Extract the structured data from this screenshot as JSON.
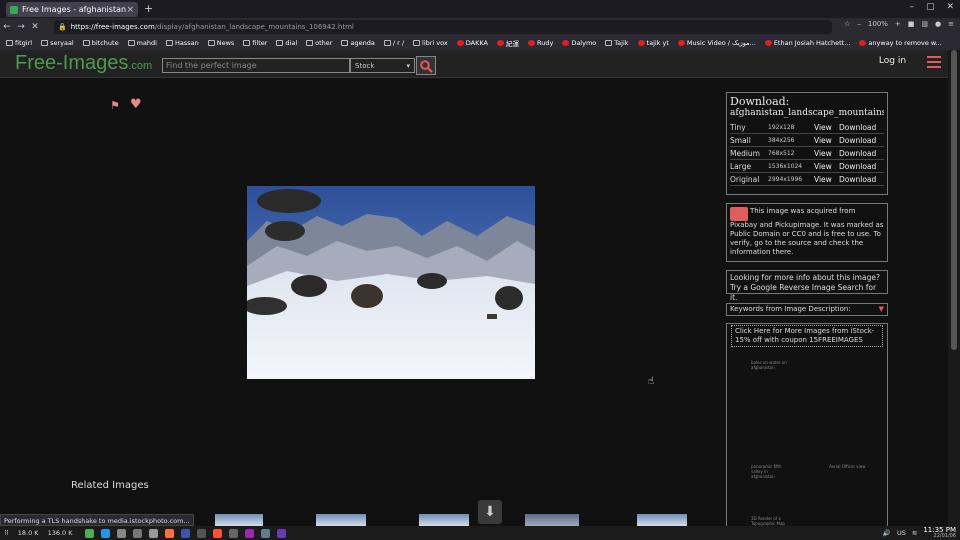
{
  "browser": {
    "tab_title": "Free Images - afghanistan",
    "tab_close": "×",
    "new_tab": "+",
    "url_host": "https://free-images.com",
    "url_path": "/display/afghanistan_landscape_mountains_106942.html",
    "zoom": "100%"
  },
  "bookmarks": [
    {
      "label": "fitgirl",
      "icon": "folder"
    },
    {
      "label": "seryaal",
      "icon": "folder"
    },
    {
      "label": "bitchute",
      "icon": "folder"
    },
    {
      "label": "mahdi",
      "icon": "folder"
    },
    {
      "label": "Hassan",
      "icon": "folder"
    },
    {
      "label": "News",
      "icon": "folder"
    },
    {
      "label": "filter",
      "icon": "folder"
    },
    {
      "label": "dial",
      "icon": "folder"
    },
    {
      "label": "other",
      "icon": "folder"
    },
    {
      "label": "agenda",
      "icon": "folder"
    },
    {
      "label": "/ r /",
      "icon": "folder"
    },
    {
      "label": "libri vox",
      "icon": "folder"
    },
    {
      "label": "DAKKA",
      "icon": "youtube"
    },
    {
      "label": "紀運",
      "icon": "youtube"
    },
    {
      "label": "Rudy",
      "icon": "youtube"
    },
    {
      "label": "Dalymo",
      "icon": "youtube"
    },
    {
      "label": "Tajik",
      "icon": "globe"
    },
    {
      "label": "tajik yt",
      "icon": "youtube"
    },
    {
      "label": "Music Video / موزیک...",
      "icon": "youtube"
    },
    {
      "label": "Ethan Josiah Hatchett...",
      "icon": "youtube"
    },
    {
      "label": "anyway to remove w...",
      "icon": "reddit"
    }
  ],
  "site": {
    "logo_main": "Free-Images",
    "logo_suffix": ".com",
    "search_placeholder": "Find the perfect image",
    "search_scope": "Stock",
    "login": "Log in"
  },
  "download_panel": {
    "title": "Download:",
    "filename": "afghanistan_landscape_mountains...",
    "rows": [
      {
        "name": "Tiny",
        "dims": "192x128",
        "view": "View",
        "download": "Download"
      },
      {
        "name": "Small",
        "dims": "384x256",
        "view": "View",
        "download": "Download"
      },
      {
        "name": "Medium",
        "dims": "768x512",
        "view": "View",
        "download": "Download"
      },
      {
        "name": "Large",
        "dims": "1536x1024",
        "view": "View",
        "download": "Download"
      },
      {
        "name": "Original",
        "dims": "2994x1996",
        "view": "View",
        "download": "Download"
      }
    ]
  },
  "info_panel": {
    "text": "This image was acquired from Pixabay and Pickupimage. It was marked as Public Domain or CC0 and is free to use. To verify, go to the source and check the information there."
  },
  "reverse_panel": {
    "text": "Looking for more info about this image? Try a Google Reverse Image Search for it."
  },
  "keywords_panel": {
    "label": "Keywords from Image Description:"
  },
  "istock_panel": {
    "text": "Click Here for More Images from iStock- 15% off with coupon 15FREEIMAGES",
    "mini_items": [
      "bales on water on afghanistan",
      "panoramic fifth valley in afghanistan",
      "Aerial Officer view",
      "3D Render of a Topographic Map"
    ]
  },
  "related_title": "Related Images",
  "status_text": "Performing a TLS handshake to media.istockphoto.com...",
  "taskbar": {
    "net_down": "18.0 K",
    "net_up": "136.0 K",
    "lang": "US",
    "time": "11:35 PM",
    "date": "22/01/06"
  }
}
